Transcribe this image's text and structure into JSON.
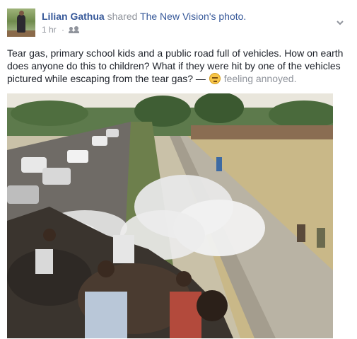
{
  "post": {
    "author": "Lilian Gathua",
    "verb": "shared",
    "source": "The New Vision's",
    "object": "photo.",
    "time": "1 hr",
    "separator": "·",
    "audience_icon": "friends-icon",
    "options_icon": "chevron-down-icon",
    "text": "Tear gas, primary school kids and a public road full of vehicles. How on earth does anyone do this to children? What if they were hit by one of the vehicles pictured while escaping from the tear gas? —",
    "feeling_emoji": "annoyed-face-emoji",
    "feeling": "feeling annoyed."
  },
  "colors": {
    "link": "#365899",
    "meta": "#90949c",
    "text": "#1d2129"
  }
}
